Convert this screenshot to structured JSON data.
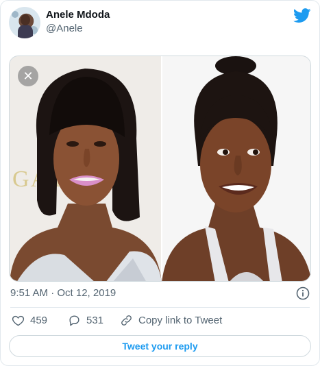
{
  "author": {
    "name": "Anele Mdoda",
    "handle": "@Anele"
  },
  "tweet": {
    "timestamp": "9:51 AM · Oct 12, 2019"
  },
  "stats": {
    "likes": "459",
    "replies": "531",
    "copy_link": "Copy link to Tweet"
  },
  "reply_button": "Tweet your reply",
  "media": {
    "backdrop_text": "GA ND."
  },
  "icons": [
    "twitter-bird-icon",
    "close-icon",
    "info-icon",
    "heart-icon",
    "reply-icon",
    "link-icon"
  ],
  "colors": {
    "accent": "#1d9bf0",
    "muted": "#536471",
    "text": "#0f1419",
    "border": "#cfd9de"
  }
}
